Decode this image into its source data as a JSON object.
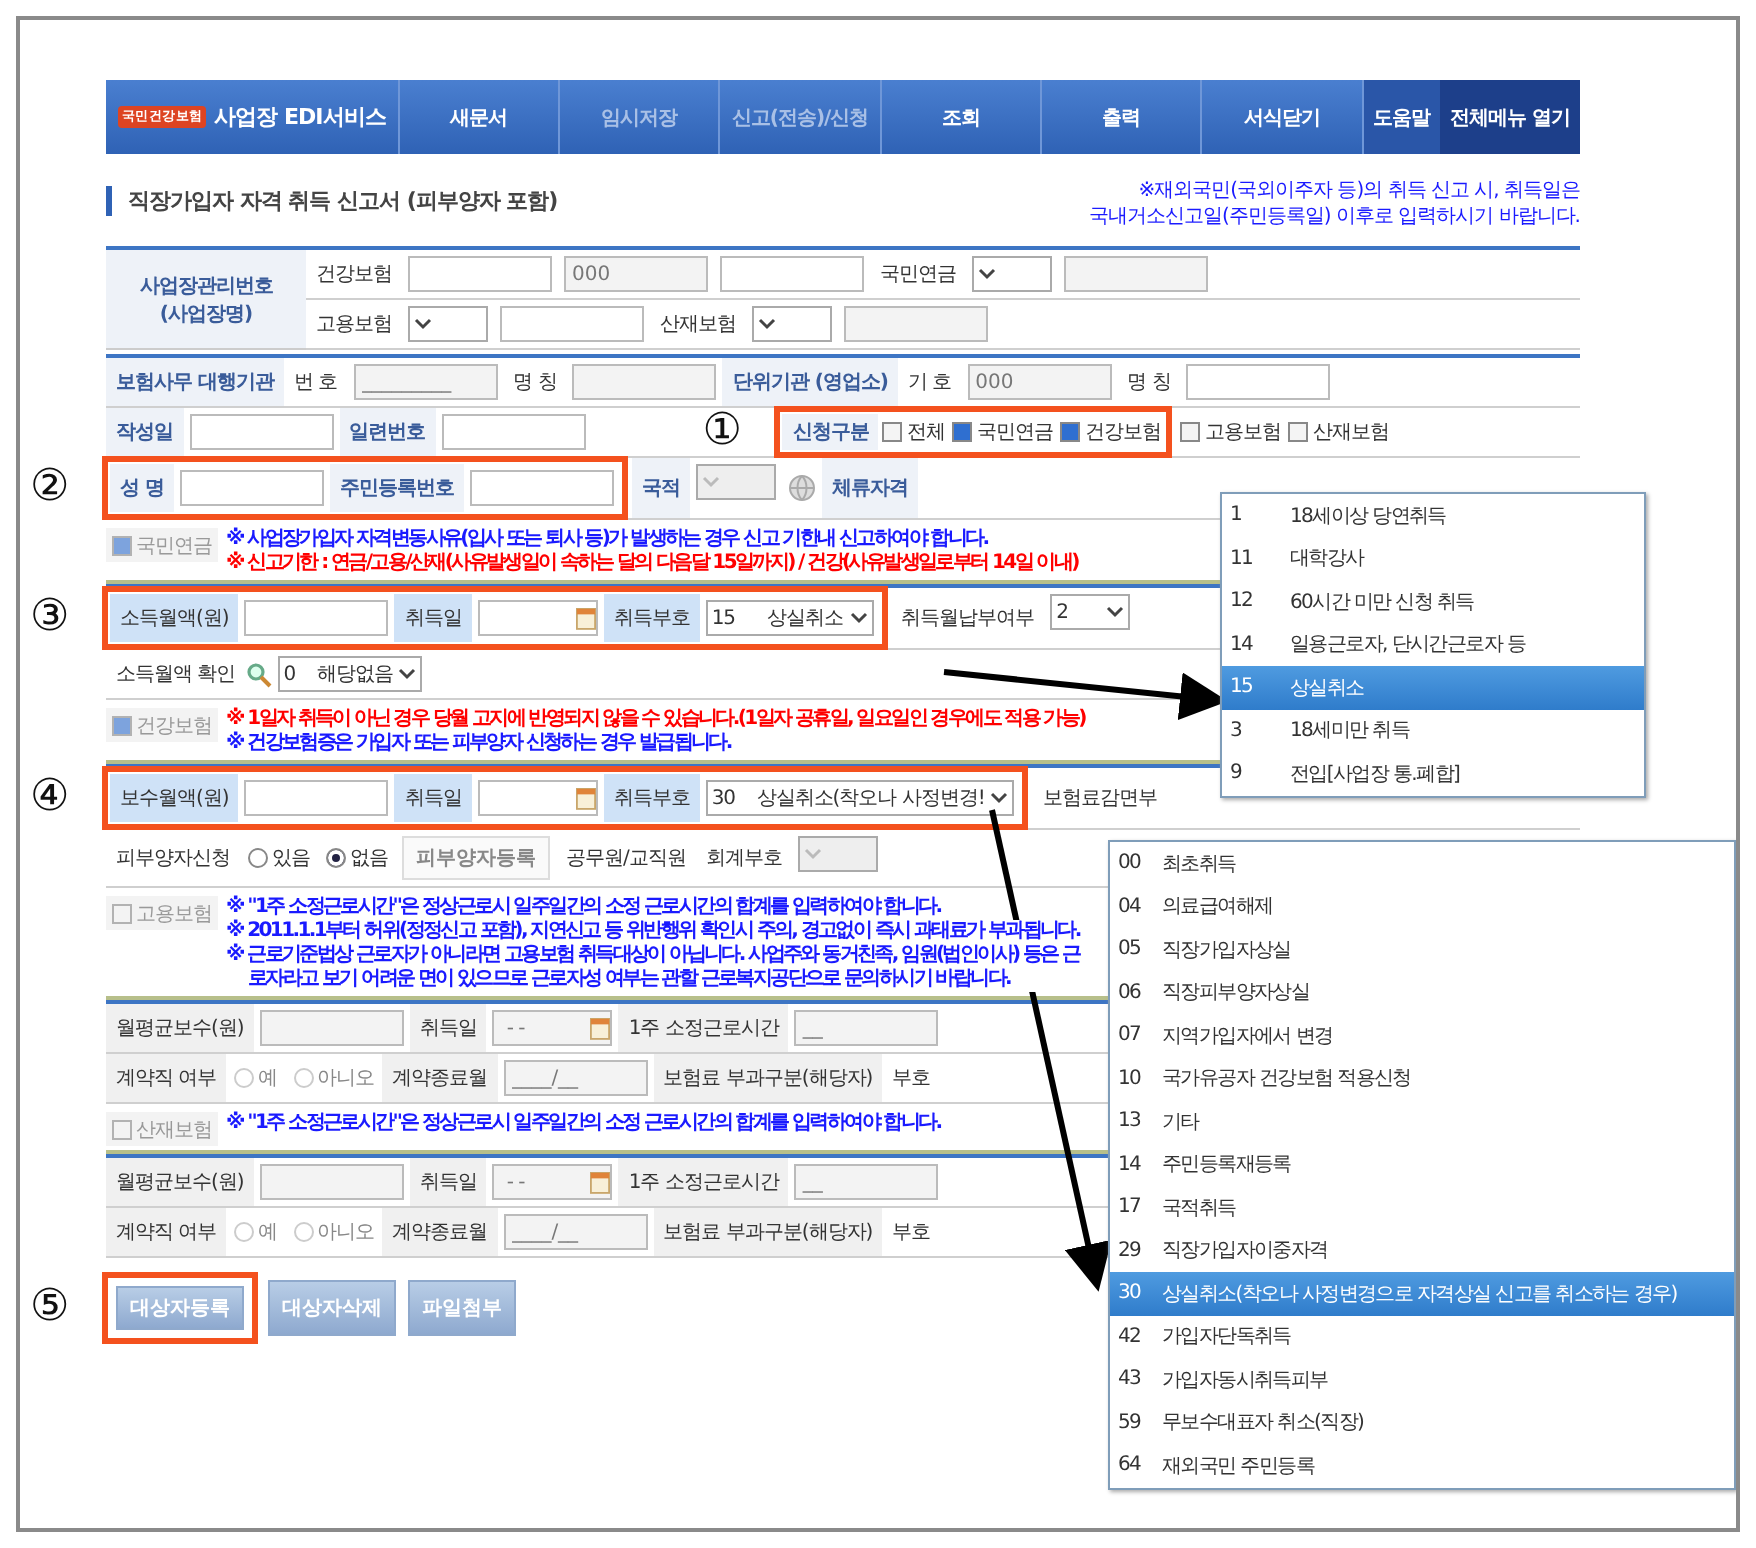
{
  "nav": {
    "logo": "국민건강보험",
    "service": "사업장 EDI서비스",
    "items": [
      {
        "label": "새문서",
        "disabled": false
      },
      {
        "label": "임시저장",
        "disabled": true
      },
      {
        "label": "신고(전송)/신청",
        "disabled": true
      },
      {
        "label": "조회",
        "disabled": false
      },
      {
        "label": "출력",
        "disabled": false
      },
      {
        "label": "서식닫기",
        "disabled": false
      }
    ],
    "help": "도움말",
    "all_menu": "전체메뉴 열기"
  },
  "title": "직장가입자 자격 취득 신고서 (피부양자 포함)",
  "title_note": [
    "※재외국민(국외이주자 등)의 취득 신고 시, 취득일은",
    "국내거소신고일(주민등록일) 이후로 입력하시기 바랍니다."
  ],
  "sections": [
    {
      "kind": "table",
      "side_label": "사업장관리번호 (사업장명)",
      "rows": [
        {
          "groups": [
            {
              "cells": [
                {
                  "kind": "label",
                  "text": "건강보험"
                },
                {
                  "kind": "input"
                },
                {
                  "kind": "input",
                  "placeholder": "000",
                  "disabled": true
                },
                {
                  "kind": "input"
                },
                {
                  "kind": "label",
                  "text": "국민연금"
                },
                {
                  "kind": "select"
                },
                {
                  "kind": "input",
                  "disabled": true
                }
              ]
            }
          ]
        },
        {
          "groups": [
            {
              "cells": [
                {
                  "kind": "label",
                  "text": "고용보험"
                },
                {
                  "kind": "select"
                },
                {
                  "kind": "input"
                },
                {
                  "kind": "label",
                  "text": "산재보험"
                },
                {
                  "kind": "select"
                },
                {
                  "kind": "input",
                  "disabled": true
                }
              ]
            }
          ]
        }
      ]
    },
    {
      "kind": "table",
      "rows": [
        {
          "groups": [
            {
              "cells": [
                {
                  "kind": "heading",
                  "text": "보험사무 대행기관"
                },
                {
                  "kind": "label",
                  "text": "번 호"
                },
                {
                  "kind": "input",
                  "placeholder": "_________",
                  "disabled": true
                },
                {
                  "kind": "label",
                  "text": "명 칭"
                },
                {
                  "kind": "input",
                  "disabled": true
                },
                {
                  "kind": "heading",
                  "text": "단위기관 (영업소)"
                },
                {
                  "kind": "label",
                  "text": "기 호"
                },
                {
                  "kind": "input",
                  "placeholder": "000",
                  "disabled": true
                },
                {
                  "kind": "label",
                  "text": "명 칭"
                },
                {
                  "kind": "input"
                }
              ]
            }
          ]
        },
        {
          "groups": [
            {
              "cells": [
                {
                  "kind": "heading",
                  "text": "작성일"
                },
                {
                  "kind": "input"
                },
                {
                  "kind": "heading",
                  "text": "일련번호"
                },
                {
                  "kind": "input"
                }
              ]
            },
            {
              "marker": "①",
              "cells": [
                {
                  "kind": "heading",
                  "text": "신청구분"
                },
                {
                  "kind": "checkbox",
                  "label": "전체",
                  "checked": false
                },
                {
                  "kind": "checkbox",
                  "label": "국민연금",
                  "checked": true
                },
                {
                  "kind": "checkbox",
                  "label": "건강보험",
                  "checked": true
                }
              ]
            },
            {
              "cells": [
                {
                  "kind": "checkbox",
                  "label": "고용보험",
                  "checked": false
                },
                {
                  "kind": "checkbox",
                  "label": "산재보험",
                  "checked": false
                }
              ]
            }
          ]
        },
        {
          "groups": [
            {
              "marker": "②",
              "cells": [
                {
                  "kind": "heading",
                  "text": "성 명"
                },
                {
                  "kind": "input"
                },
                {
                  "kind": "heading",
                  "text": "주민등록번호"
                },
                {
                  "kind": "input"
                }
              ]
            },
            {
              "cells": [
                {
                  "kind": "heading",
                  "text": "국적"
                },
                {
                  "kind": "select",
                  "disabled": true
                },
                {
                  "kind": "info"
                },
                {
                  "kind": "heading",
                  "text": "체류자격"
                }
              ]
            }
          ]
        }
      ]
    },
    {
      "kind": "notes",
      "toggle": {
        "label": "국민연금",
        "checked": true
      },
      "lines": [
        {
          "text": "※ 사업장가입자 자격변동사유(입사 또는 퇴사 등)가 발생하는 경우 신고 기한내 신고하여야 합니다.",
          "color": "#1a1aff"
        },
        {
          "text": "※ 신고기한 : 연금/고용/산재(사유발생일이 속하는 달의 다음달 15일까지) / 건강(사유발생일로부터 14일 이내)",
          "color": "#ff0000"
        }
      ]
    },
    {
      "kind": "table",
      "rows": [
        {
          "groups": [
            {
              "marker": "③",
              "cells": [
                {
                  "kind": "bluelabel",
                  "text": "소득월액(원)"
                },
                {
                  "kind": "input"
                },
                {
                  "kind": "bluelabel",
                  "text": "취득일"
                },
                {
                  "kind": "date"
                },
                {
                  "kind": "bluelabel",
                  "text": "취득부호"
                },
                {
                  "kind": "select",
                  "value": "15      상실취소"
                }
              ]
            },
            {
              "cells": [
                {
                  "kind": "label",
                  "text": "취득월납부여부"
                },
                {
                  "kind": "select",
                  "value": "2"
                }
              ]
            }
          ]
        },
        {
          "groups": [
            {
              "cells": [
                {
                  "kind": "label",
                  "text": "소득월액 확인"
                },
                {
                  "kind": "lookup"
                },
                {
                  "kind": "select",
                  "value": "0    해당없음"
                }
              ]
            }
          ]
        }
      ]
    },
    {
      "kind": "notes",
      "toggle": {
        "label": "건강보험",
        "checked": true
      },
      "lines": [
        {
          "text": "※ 1일자 취득이 아닌 경우 당월 고지에 반영되지 않을 수 있습니다.(1일자 공휴일, 일요일인 경우에도 적용 가능)",
          "color": "#ff0000"
        },
        {
          "text": "※ 건강보험증은 가입자 또는 피부양자 신청하는 경우 발급됩니다.",
          "color": "#1a1aff"
        }
      ]
    },
    {
      "kind": "table",
      "rows": [
        {
          "groups": [
            {
              "marker": "④",
              "cells": [
                {
                  "kind": "bluelabel",
                  "text": "보수월액(원)"
                },
                {
                  "kind": "input"
                },
                {
                  "kind": "bluelabel",
                  "text": "취득일"
                },
                {
                  "kind": "date"
                },
                {
                  "kind": "bluelabel",
                  "text": "취득부호"
                },
                {
                  "kind": "select",
                  "value": "30    상실취소(착오나 사정변경!"
                }
              ]
            },
            {
              "cells": [
                {
                  "kind": "label",
                  "text": "보험료감면부"
                }
              ]
            }
          ]
        },
        {
          "groups": [
            {
              "cells": [
                {
                  "kind": "label",
                  "text": "피부양자신청"
                },
                {
                  "kind": "radio",
                  "label": "있음",
                  "selected": false,
                  "disabled": false
                },
                {
                  "kind": "radio",
                  "label": "없음",
                  "selected": true,
                  "disabled": false
                },
                {
                  "kind": "button",
                  "label": "피부양자등록",
                  "disabled": true
                },
                {
                  "kind": "label",
                  "text": "공무원/교직원"
                },
                {
                  "kind": "label",
                  "text": "회계부호"
                },
                {
                  "kind": "select",
                  "disabled": true
                }
              ]
            }
          ]
        }
      ]
    },
    {
      "kind": "notes",
      "toggle": {
        "label": "고용보험",
        "checked": false
      },
      "lines": [
        {
          "text": "※ \"1주 소정근로시간\"은 정상근로시 일주일간의  소정 근로시간의 합계를 입력하여야 합니다.",
          "color": "#1a1aff"
        },
        {
          "text": "※ 2011.1.1부터 허위(정정신고 포함), 지연신고 등 위반행위 확인시 주의, 경고없이 즉시 과태료가 부과됩니다.",
          "color": "#1a1aff"
        },
        {
          "text": "※ 근로기준법상 근로자가 아니라면 고용보험 취득대상이 아닙니다. 사업주와 동거친족, 임원(법인이사) 등은 근로자라고 보기 어려운 면이 있으므로 근로자성 여부는 관할 근로복지공단으로 문의하시기 바랍니다.",
          "color": "#1a1aff"
        }
      ]
    },
    {
      "kind": "table",
      "rows": [
        {
          "groups": [
            {
              "cells": [
                {
                  "kind": "graylabel",
                  "text": "월평균보수(원)"
                },
                {
                  "kind": "input",
                  "disabled": true
                },
                {
                  "kind": "graylabel",
                  "text": "취득일"
                },
                {
                  "kind": "date",
                  "placeholder": "-  -",
                  "disabled": true
                },
                {
                  "kind": "graylabel",
                  "text": "1주 소정근로시간"
                },
                {
                  "kind": "input",
                  "placeholder": "__",
                  "disabled": true
                }
              ]
            }
          ]
        },
        {
          "groups": [
            {
              "cells": [
                {
                  "kind": "graylabel",
                  "text": "계약직 여부"
                },
                {
                  "kind": "radio",
                  "label": "예",
                  "selected": false,
                  "disabled": true
                },
                {
                  "kind": "radio",
                  "label": "아니오",
                  "selected": false,
                  "disabled": true
                },
                {
                  "kind": "graylabel",
                  "text": "계약종료월"
                },
                {
                  "kind": "input",
                  "placeholder": "____/__",
                  "disabled": true
                },
                {
                  "kind": "graylabel",
                  "text": "보험료 부과구분(해당자)"
                },
                {
                  "kind": "label",
                  "text": "부호"
                }
              ]
            }
          ]
        }
      ]
    },
    {
      "kind": "notes",
      "toggle": {
        "label": "산재보험",
        "checked": false
      },
      "lines": [
        {
          "text": "※ \"1주 소정근로시간\"은 정상근로시 일주일간의  소정 근로시간의 합계를 입력하여야 합니다.",
          "color": "#1a1aff"
        }
      ]
    },
    {
      "kind": "table",
      "rows": [
        {
          "groups": [
            {
              "cells": [
                {
                  "kind": "graylabel",
                  "text": "월평균보수(원)"
                },
                {
                  "kind": "input",
                  "disabled": true
                },
                {
                  "kind": "graylabel",
                  "text": "취득일"
                },
                {
                  "kind": "date",
                  "placeholder": "-  -",
                  "disabled": true
                },
                {
                  "kind": "graylabel",
                  "text": "1주 소정근로시간"
                },
                {
                  "kind": "input",
                  "placeholder": "__",
                  "disabled": true
                }
              ]
            }
          ]
        },
        {
          "groups": [
            {
              "cells": [
                {
                  "kind": "graylabel",
                  "text": "계약직 여부"
                },
                {
                  "kind": "radio",
                  "label": "예",
                  "selected": false,
                  "disabled": true
                },
                {
                  "kind": "radio",
                  "label": "아니오",
                  "selected": false,
                  "disabled": true
                },
                {
                  "kind": "graylabel",
                  "text": "계약종료월"
                },
                {
                  "kind": "input",
                  "placeholder": "____/__",
                  "disabled": true
                },
                {
                  "kind": "graylabel",
                  "text": "보험료 부과구분(해당자)"
                },
                {
                  "kind": "label",
                  "text": "부호"
                }
              ]
            }
          ]
        }
      ]
    },
    {
      "kind": "buttons",
      "rows": [
        {
          "groups": [
            {
              "marker": "⑤",
              "cells": [
                {
                  "kind": "button",
                  "label": "대상자등록",
                  "disabled": false
                }
              ]
            },
            {
              "cells": [
                {
                  "kind": "button",
                  "label": "대상자삭제",
                  "disabled": false
                },
                {
                  "kind": "button",
                  "label": "파일첨부",
                  "disabled": false
                }
              ]
            }
          ]
        }
      ]
    }
  ],
  "dropdowns": [
    {
      "items": [
        {
          "code": "1",
          "label": "18세이상 당연취득",
          "selected": false
        },
        {
          "code": "11",
          "label": "대학강사",
          "selected": false
        },
        {
          "code": "12",
          "label": "60시간 미만 신청 취득",
          "selected": false
        },
        {
          "code": "14",
          "label": "일용근로자, 단시간근로자 등",
          "selected": false
        },
        {
          "code": "15",
          "label": "상실취소",
          "selected": true
        },
        {
          "code": "3",
          "label": "18세미만 취득",
          "selected": false
        },
        {
          "code": "9",
          "label": "전입[사업장 통.폐합]",
          "selected": false
        }
      ]
    },
    {
      "items": [
        {
          "code": "00",
          "label": "최초취득",
          "selected": false
        },
        {
          "code": "04",
          "label": "의료급여해제",
          "selected": false
        },
        {
          "code": "05",
          "label": "직장가입자상실",
          "selected": false
        },
        {
          "code": "06",
          "label": "직장피부양자상실",
          "selected": false
        },
        {
          "code": "07",
          "label": "지역가입자에서 변경",
          "selected": false
        },
        {
          "code": "10",
          "label": "국가유공자 건강보험 적용신청",
          "selected": false
        },
        {
          "code": "13",
          "label": "기타",
          "selected": false
        },
        {
          "code": "14",
          "label": "주민등록재등록",
          "selected": false
        },
        {
          "code": "17",
          "label": "국적취득",
          "selected": false
        },
        {
          "code": "29",
          "label": "직장가입자이중자격",
          "selected": false
        },
        {
          "code": "30",
          "label": "상실취소(착오나 사정변경으로 자격상실 신고를 취소하는 경우)",
          "selected": true
        },
        {
          "code": "42",
          "label": "가입자단독취득",
          "selected": false
        },
        {
          "code": "43",
          "label": "가입자동시취득피부",
          "selected": false
        },
        {
          "code": "59",
          "label": "무보수대표자 취소(직장)",
          "selected": false
        },
        {
          "code": "64",
          "label": "재외국민 주민등록",
          "selected": false
        }
      ]
    }
  ]
}
